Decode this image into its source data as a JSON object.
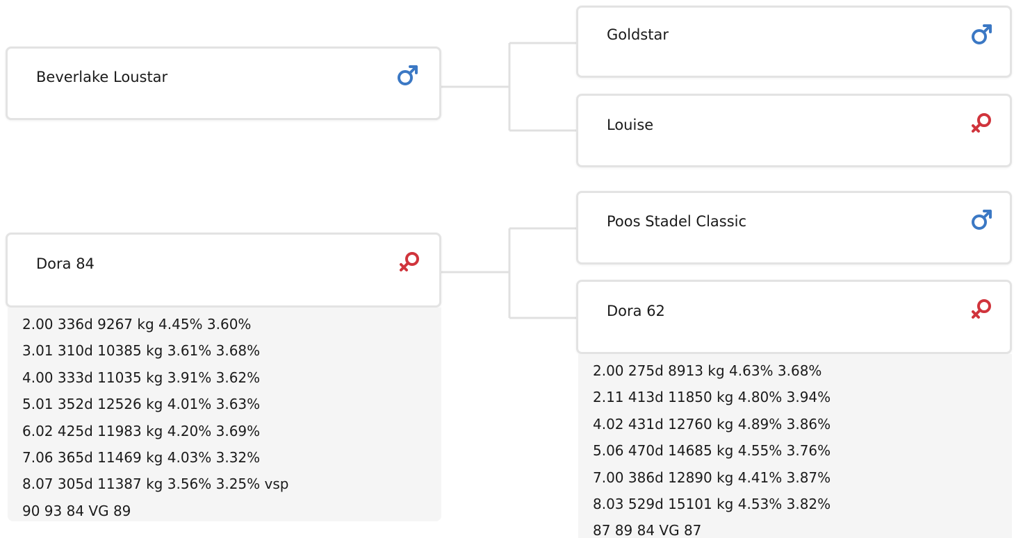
{
  "colors": {
    "male": "#3b78c4",
    "female": "#d0343c",
    "card_border": "#e3e3e3",
    "info_bg": "#f5f5f5",
    "connector": "#e0e0e0"
  },
  "pedigree": {
    "sire": {
      "name": "Beverlake Loustar",
      "gender": "male",
      "gender_icon": "male-icon",
      "sire": {
        "name": "Goldstar",
        "gender": "male",
        "gender_icon": "male-icon"
      },
      "dam": {
        "name": "Louise",
        "gender": "female",
        "gender_icon": "female-icon"
      }
    },
    "dam": {
      "name": "Dora 84",
      "gender": "female",
      "gender_icon": "female-icon",
      "records": [
        "2.00 336d 9267 kg 4.45% 3.60%",
        "3.01 310d 10385 kg 3.61% 3.68%",
        "4.00 333d 11035 kg 3.91% 3.62%",
        "5.01 352d 12526 kg 4.01% 3.63%",
        "6.02 425d 11983 kg 4.20% 3.69%",
        "7.06 365d 11469 kg 4.03% 3.32%",
        "8.07 305d 11387 kg 3.56% 3.25% vsp",
        "90 93 84 VG 89"
      ],
      "sire": {
        "name": "Poos Stadel Classic",
        "gender": "male",
        "gender_icon": "male-icon"
      },
      "dam": {
        "name": "Dora 62",
        "gender": "female",
        "gender_icon": "female-icon",
        "records": [
          "2.00 275d 8913 kg 4.63% 3.68%",
          "2.11 413d 11850 kg 4.80% 3.94%",
          "4.02 431d 12760 kg 4.89% 3.86%",
          "5.06 470d 14685 kg 4.55% 3.76%",
          "7.00 386d 12890 kg 4.41% 3.87%",
          "8.03 529d 15101 kg 4.53% 3.82%",
          "87 89 84 VG 87"
        ]
      }
    }
  }
}
